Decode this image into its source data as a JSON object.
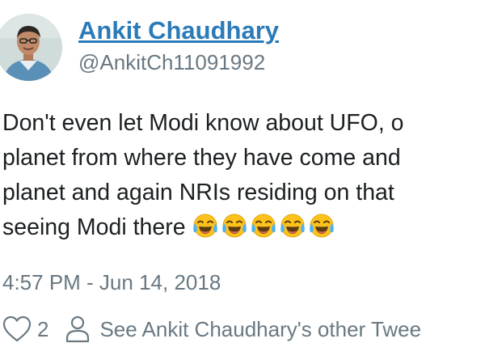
{
  "tweet": {
    "author_name": "Ankit Chaudhary",
    "author_handle": "@AnkitCh11091992",
    "text_lines": [
      "Don't even let Modi know about UFO, o",
      "planet from where they have come and",
      "planet and again NRIs residing on that",
      "seeing Modi there"
    ],
    "emoji": [
      "face-with-tears-of-joy",
      "face-with-tears-of-joy",
      "face-with-tears-of-joy",
      "face-with-tears-of-joy",
      "face-with-tears-of-joy"
    ],
    "timestamp": "4:57 PM - Jun 14, 2018",
    "like_count": "2",
    "see_more_label": "See Ankit Chaudhary's other Twee"
  },
  "icons": {
    "like": "heart-icon",
    "profile": "person-icon"
  },
  "colors": {
    "link": "#2b7bb9",
    "muted": "#697882",
    "text": "#1c2022"
  }
}
